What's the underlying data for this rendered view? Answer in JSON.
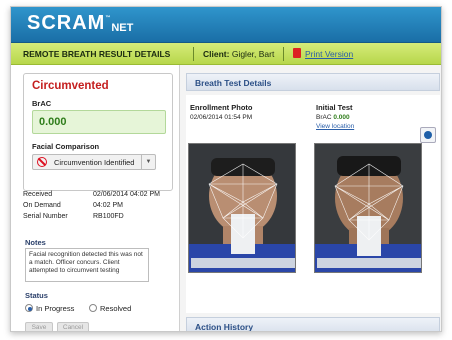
{
  "brand": {
    "logo_main": "SCRAM",
    "logo_sup": "NET",
    "logo_tm": "™"
  },
  "titlebar": {
    "title": "REMOTE BREATH RESULT DETAILS",
    "client_label": "Client:",
    "client_name": "Gigler, Bart",
    "print_link": "Print Version"
  },
  "summary": {
    "result": "Circumvented",
    "brac_label": "BrAC",
    "brac_value": "0.000",
    "facial_label": "Facial Comparison",
    "facial_value": "Circumvention Identified"
  },
  "meta": [
    {
      "key": "Received",
      "value": "02/06/2014 04:02 PM"
    },
    {
      "key": "On Demand",
      "value": "04:02 PM"
    },
    {
      "key": "Serial Number",
      "value": "RB100FD"
    }
  ],
  "notes": {
    "label": "Notes",
    "text": "Facial recognition detected this was not a match. Officer concurs. Client attempted to circumvent testing"
  },
  "status": {
    "label": "Status",
    "options": [
      "In Progress",
      "Resolved"
    ],
    "selected": "In Progress"
  },
  "buttons": {
    "save": "Save",
    "cancel": "Cancel"
  },
  "breath_test": {
    "header": "Breath Test Details",
    "enrollment": {
      "title": "Enrollment Photo",
      "date": "02/06/2014 01:54 PM"
    },
    "initial": {
      "title": "Initial Test",
      "brac_label": "BrAC",
      "brac_value": "0.000",
      "link": "View location"
    }
  },
  "action_history": {
    "header": "Action History"
  },
  "colors": {
    "accent_blue": "#1a6ea6",
    "title_green": "#b7d74b",
    "alert_red": "#c41e1e",
    "ok_green": "#2f7d1b"
  }
}
